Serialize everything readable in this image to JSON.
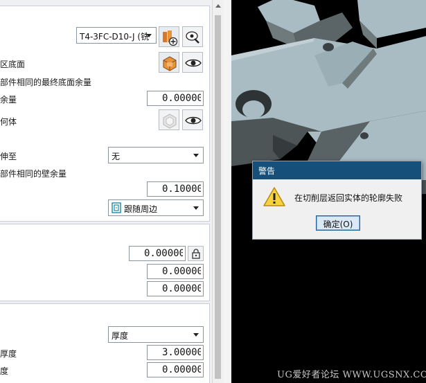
{
  "dialog_panel": {
    "group1": {
      "tool_select": "T4-3FC-D10-J (铣",
      "cut_area_floor_label": "区底面",
      "same_floor_stock_label": "部件相同的最终底面余量",
      "stock_label": "余量",
      "stock_value": "0.00000",
      "geometry_label": "何体",
      "section_link": "",
      "extend_to_label": "伸至",
      "extend_to_value": "无",
      "same_wall_stock_label": "部件相同的壁余量",
      "wall_stock_value": "0.10000",
      "follow_select": "跟随周边"
    },
    "group2": {
      "value1": "0.00000",
      "value2": "0.00000",
      "value3": "0.00000"
    },
    "group3": {
      "thickness_select": "厚度",
      "thickness_label": "厚度",
      "thickness_value": "3.00000",
      "degree_label": "度",
      "degree_value": "0.00000"
    }
  },
  "warning_dialog": {
    "title": "警告",
    "message": "在切削层返回实体的轮廓失败",
    "ok_button": "确定(O)"
  },
  "watermark": "UG爱好者论坛 WWW.UGSNX.COM",
  "colors": {
    "dialog_title_bar": "#16507a",
    "model_face": "#a9bcc3",
    "model_side": "#5b6466",
    "background": "#000000"
  }
}
